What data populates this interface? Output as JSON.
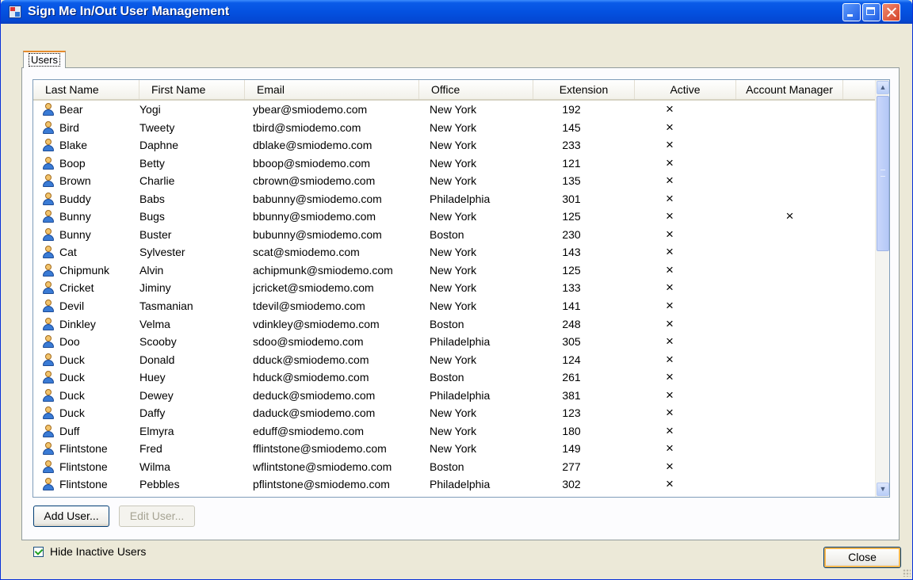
{
  "window": {
    "title": "Sign Me In/Out User Management"
  },
  "tabs": [
    {
      "label": "Users"
    }
  ],
  "list": {
    "columns": [
      "Last Name",
      "First Name",
      "Email",
      "Office",
      "Extension",
      "Active",
      "Account Manager"
    ],
    "rows": [
      {
        "last": "Bear",
        "first": "Yogi",
        "email": "ybear@smiodemo.com",
        "office": "New York",
        "ext": "192",
        "active": "×",
        "manager": ""
      },
      {
        "last": "Bird",
        "first": "Tweety",
        "email": "tbird@smiodemo.com",
        "office": "New York",
        "ext": "145",
        "active": "×",
        "manager": ""
      },
      {
        "last": "Blake",
        "first": "Daphne",
        "email": "dblake@smiodemo.com",
        "office": "New York",
        "ext": "233",
        "active": "×",
        "manager": ""
      },
      {
        "last": "Boop",
        "first": "Betty",
        "email": "bboop@smiodemo.com",
        "office": "New York",
        "ext": "121",
        "active": "×",
        "manager": ""
      },
      {
        "last": "Brown",
        "first": "Charlie",
        "email": "cbrown@smiodemo.com",
        "office": "New York",
        "ext": "135",
        "active": "×",
        "manager": ""
      },
      {
        "last": "Buddy",
        "first": "Babs",
        "email": "babunny@smiodemo.com",
        "office": "Philadelphia",
        "ext": "301",
        "active": "×",
        "manager": ""
      },
      {
        "last": "Bunny",
        "first": "Bugs",
        "email": "bbunny@smiodemo.com",
        "office": "New York",
        "ext": "125",
        "active": "×",
        "manager": "×"
      },
      {
        "last": "Bunny",
        "first": "Buster",
        "email": "bubunny@smiodemo.com",
        "office": "Boston",
        "ext": "230",
        "active": "×",
        "manager": ""
      },
      {
        "last": "Cat",
        "first": "Sylvester",
        "email": "scat@smiodemo.com",
        "office": "New York",
        "ext": "143",
        "active": "×",
        "manager": ""
      },
      {
        "last": "Chipmunk",
        "first": "Alvin",
        "email": "achipmunk@smiodemo.com",
        "office": "New York",
        "ext": "125",
        "active": "×",
        "manager": ""
      },
      {
        "last": "Cricket",
        "first": "Jiminy",
        "email": "jcricket@smiodemo.com",
        "office": "New York",
        "ext": "133",
        "active": "×",
        "manager": ""
      },
      {
        "last": "Devil",
        "first": "Tasmanian",
        "email": "tdevil@smiodemo.com",
        "office": "New York",
        "ext": "141",
        "active": "×",
        "manager": ""
      },
      {
        "last": "Dinkley",
        "first": "Velma",
        "email": "vdinkley@smiodemo.com",
        "office": "Boston",
        "ext": "248",
        "active": "×",
        "manager": ""
      },
      {
        "last": "Doo",
        "first": "Scooby",
        "email": "sdoo@smiodemo.com",
        "office": "Philadelphia",
        "ext": "305",
        "active": "×",
        "manager": ""
      },
      {
        "last": "Duck",
        "first": "Donald",
        "email": "dduck@smiodemo.com",
        "office": "New York",
        "ext": "124",
        "active": "×",
        "manager": ""
      },
      {
        "last": "Duck",
        "first": "Huey",
        "email": "hduck@smiodemo.com",
        "office": "Boston",
        "ext": "261",
        "active": "×",
        "manager": ""
      },
      {
        "last": "Duck",
        "first": "Dewey",
        "email": "deduck@smiodemo.com",
        "office": "Philadelphia",
        "ext": "381",
        "active": "×",
        "manager": ""
      },
      {
        "last": "Duck",
        "first": "Daffy",
        "email": "daduck@smiodemo.com",
        "office": "New York",
        "ext": "123",
        "active": "×",
        "manager": ""
      },
      {
        "last": "Duff",
        "first": "Elmyra",
        "email": "eduff@smiodemo.com",
        "office": "New York",
        "ext": "180",
        "active": "×",
        "manager": ""
      },
      {
        "last": "Flintstone",
        "first": "Fred",
        "email": "fflintstone@smiodemo.com",
        "office": "New York",
        "ext": "149",
        "active": "×",
        "manager": ""
      },
      {
        "last": "Flintstone",
        "first": "Wilma",
        "email": "wflintstone@smiodemo.com",
        "office": "Boston",
        "ext": "277",
        "active": "×",
        "manager": ""
      },
      {
        "last": "Flintstone",
        "first": "Pebbles",
        "email": "pflintstone@smiodemo.com",
        "office": "Philadelphia",
        "ext": "302",
        "active": "×",
        "manager": ""
      }
    ]
  },
  "buttons": {
    "add_user": "Add User...",
    "edit_user": "Edit User...",
    "close": "Close"
  },
  "options": {
    "hide_inactive_label": "Hide Inactive Users",
    "hide_inactive_checked": true
  },
  "icons": {
    "user": "user-icon",
    "app": "app-icon"
  },
  "colors": {
    "titlebar": "#0451e0",
    "tab_highlight": "#e68b2c",
    "checkmark": "#21a121"
  }
}
